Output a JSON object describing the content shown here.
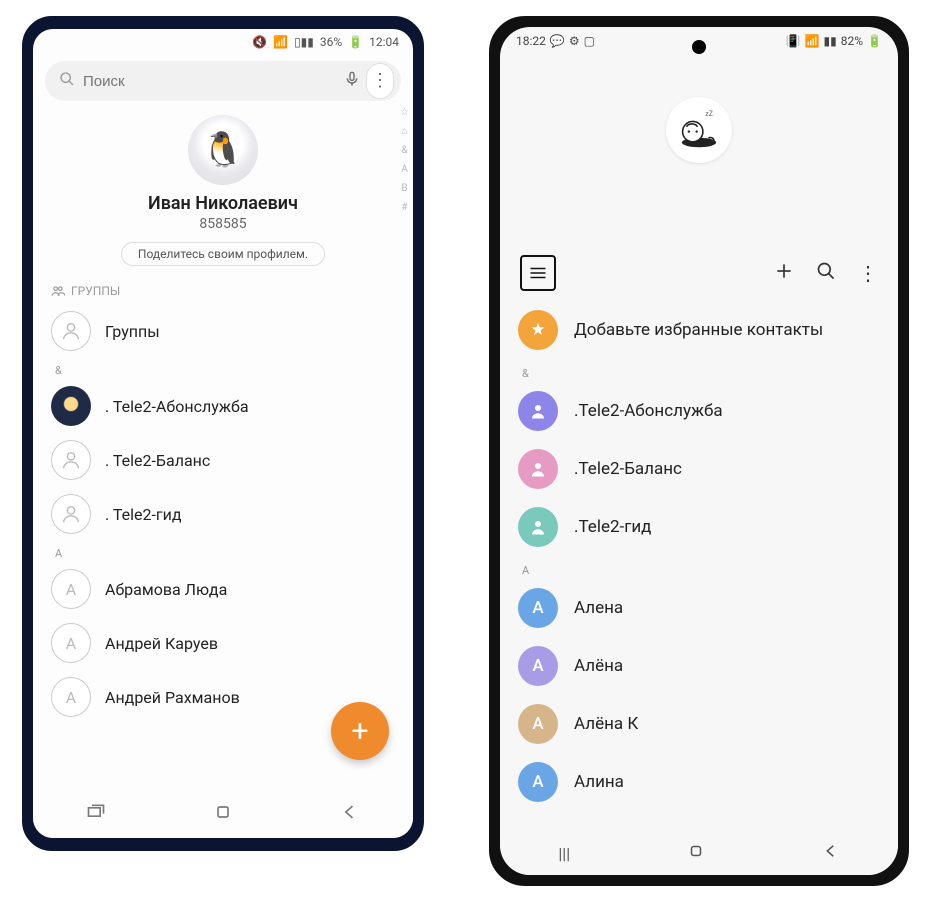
{
  "left": {
    "status": {
      "battery": "36%",
      "time": "12:04"
    },
    "search": {
      "placeholder": "Поиск"
    },
    "profile": {
      "name": "Иван Николаевич",
      "number": "858585",
      "share": "Поделитесь своим профилем."
    },
    "index_strip": [
      "☆",
      "⌂",
      "&",
      "A",
      "B",
      "#"
    ],
    "groups_header": "ГРУППЫ",
    "groups_row": "Группы",
    "amp_header": "&",
    "amp_rows": [
      ". Tele2-Абонслужба",
      ". Tele2-Баланс",
      ". Tele2-гид"
    ],
    "a_header": "A",
    "a_rows": [
      "Абрамова Люда",
      "Андрей Каруев",
      "Андрей Рахманов"
    ],
    "fab": "+"
  },
  "right": {
    "status": {
      "time": "18:22",
      "battery": "82%"
    },
    "fav_row": "Добавьте избранные контакты",
    "amp_header": "&",
    "contacts": [
      {
        "name": ".Tele2-Абонслужба",
        "color": "bg-purple"
      },
      {
        "name": ".Tele2-Баланс",
        "color": "bg-pink"
      },
      {
        "name": ".Tele2-гид",
        "color": "bg-teal"
      }
    ],
    "a_header": "A",
    "a_contacts": [
      {
        "name": "Алена",
        "letter": "А",
        "color": "bg-blue"
      },
      {
        "name": "Алёна",
        "letter": "А",
        "color": "bg-lilac"
      },
      {
        "name": "Алёна К",
        "letter": "А",
        "color": "bg-tan"
      },
      {
        "name": "Алина",
        "letter": "А",
        "color": "bg-blue2"
      }
    ]
  }
}
